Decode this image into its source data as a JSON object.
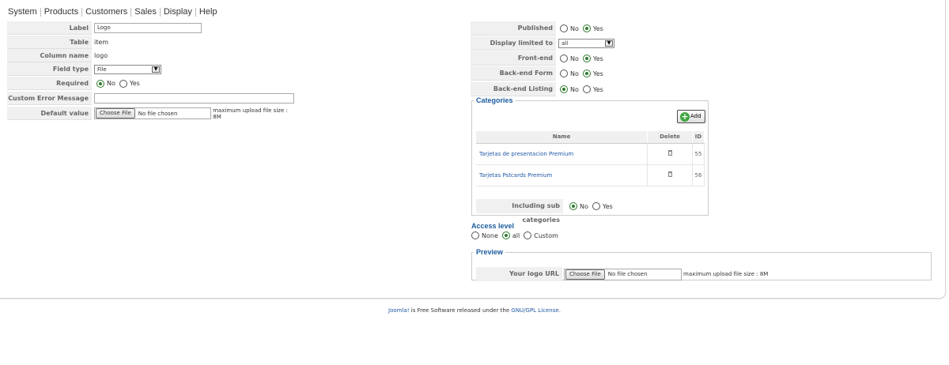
{
  "menu": [
    "System",
    "Products",
    "Customers",
    "Sales",
    "Display",
    "Help"
  ],
  "left_form": {
    "label": {
      "label": "Label",
      "value": "Logo"
    },
    "table": {
      "label": "Table",
      "value": "item"
    },
    "column_name": {
      "label": "Column name",
      "value": "logo"
    },
    "field_type": {
      "label": "Field type",
      "value": "File"
    },
    "required": {
      "label": "Required",
      "opt_no": "No",
      "opt_yes": "Yes",
      "selected": "No"
    },
    "custom_error": {
      "label": "Custom Error Message",
      "value": ""
    },
    "default_value": {
      "label": "Default value",
      "button": "Choose File",
      "file_status": "No file chosen",
      "max_size": "maximum upload file size : 8M"
    }
  },
  "right_form": {
    "published": {
      "label": "Published",
      "opt_no": "No",
      "opt_yes": "Yes",
      "selected": "Yes"
    },
    "display_limited": {
      "label": "Display limited to",
      "value": "all"
    },
    "front_end": {
      "label": "Front-end",
      "opt_no": "No",
      "opt_yes": "Yes",
      "selected": "Yes"
    },
    "backend_form": {
      "label": "Back-end Form",
      "opt_no": "No",
      "opt_yes": "Yes",
      "selected": "Yes"
    },
    "backend_listing": {
      "label": "Back-end Listing",
      "opt_no": "No",
      "opt_yes": "Yes",
      "selected": "No"
    }
  },
  "categories": {
    "title": "Categories",
    "add_label": "Add",
    "columns": {
      "name": "Name",
      "delete": "Delete",
      "id": "ID"
    },
    "rows": [
      {
        "name": "Tarjetas de presentacion Premium",
        "id": "55"
      },
      {
        "name": "Tarjetas Pstcards Premium",
        "id": "56"
      }
    ],
    "sub": {
      "label": "Including sub categories",
      "opt_no": "No",
      "opt_yes": "Yes",
      "selected": "No"
    }
  },
  "access": {
    "title": "Access level",
    "opt_none": "None",
    "opt_all": "all",
    "opt_custom": "Custom",
    "selected": "all"
  },
  "preview": {
    "title": "Preview",
    "label": "Your logo URL",
    "button": "Choose File",
    "file_status": "No file chosen",
    "max_size": "maximum upload file size : 8M"
  },
  "footer": {
    "link1": "Joomla!",
    "middle": " is Free Software released under the ",
    "link2": "GNU/GPL License",
    "end": "."
  },
  "colors": {
    "accent": "#1a5c9e",
    "radio_on": "#2e7a2e",
    "link": "#1f58a4"
  }
}
